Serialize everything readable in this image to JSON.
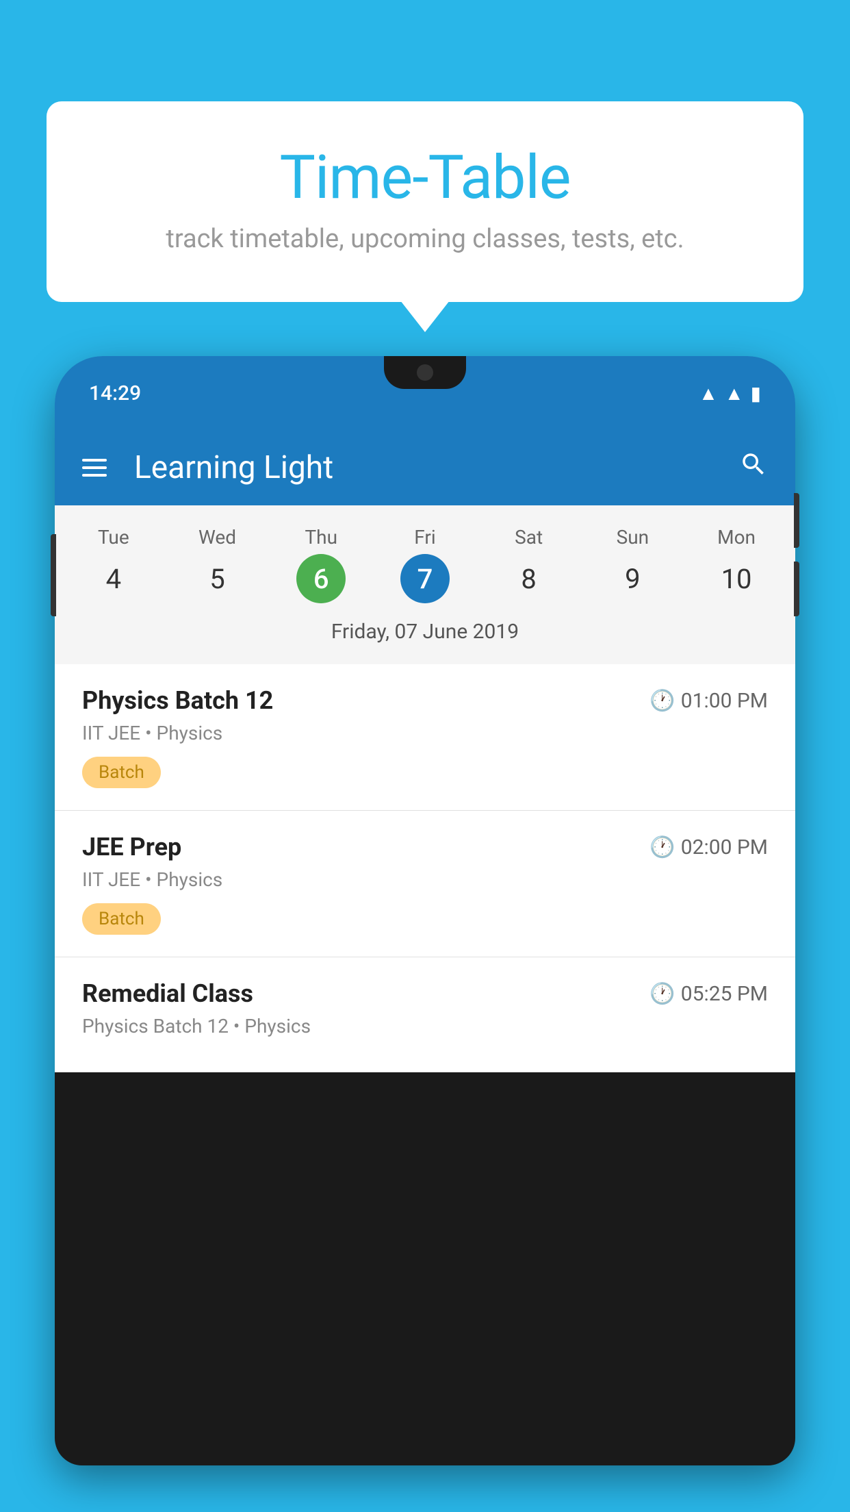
{
  "background_color": "#29b6e8",
  "bubble": {
    "title": "Time-Table",
    "subtitle": "track timetable, upcoming classes, tests, etc."
  },
  "phone": {
    "status_bar": {
      "time": "14:29"
    },
    "app_bar": {
      "title": "Learning Light"
    },
    "calendar": {
      "days": [
        {
          "name": "Tue",
          "number": "4",
          "state": "normal"
        },
        {
          "name": "Wed",
          "number": "5",
          "state": "normal"
        },
        {
          "name": "Thu",
          "number": "6",
          "state": "today"
        },
        {
          "name": "Fri",
          "number": "7",
          "state": "selected"
        },
        {
          "name": "Sat",
          "number": "8",
          "state": "normal"
        },
        {
          "name": "Sun",
          "number": "9",
          "state": "normal"
        },
        {
          "name": "Mon",
          "number": "10",
          "state": "normal"
        }
      ],
      "selected_date_label": "Friday, 07 June 2019"
    },
    "schedule": [
      {
        "title": "Physics Batch 12",
        "time": "01:00 PM",
        "subtitle": "IIT JEE • Physics",
        "badge": "Batch"
      },
      {
        "title": "JEE Prep",
        "time": "02:00 PM",
        "subtitle": "IIT JEE • Physics",
        "badge": "Batch"
      },
      {
        "title": "Remedial Class",
        "time": "05:25 PM",
        "subtitle": "Physics Batch 12 • Physics",
        "badge": null
      }
    ]
  }
}
